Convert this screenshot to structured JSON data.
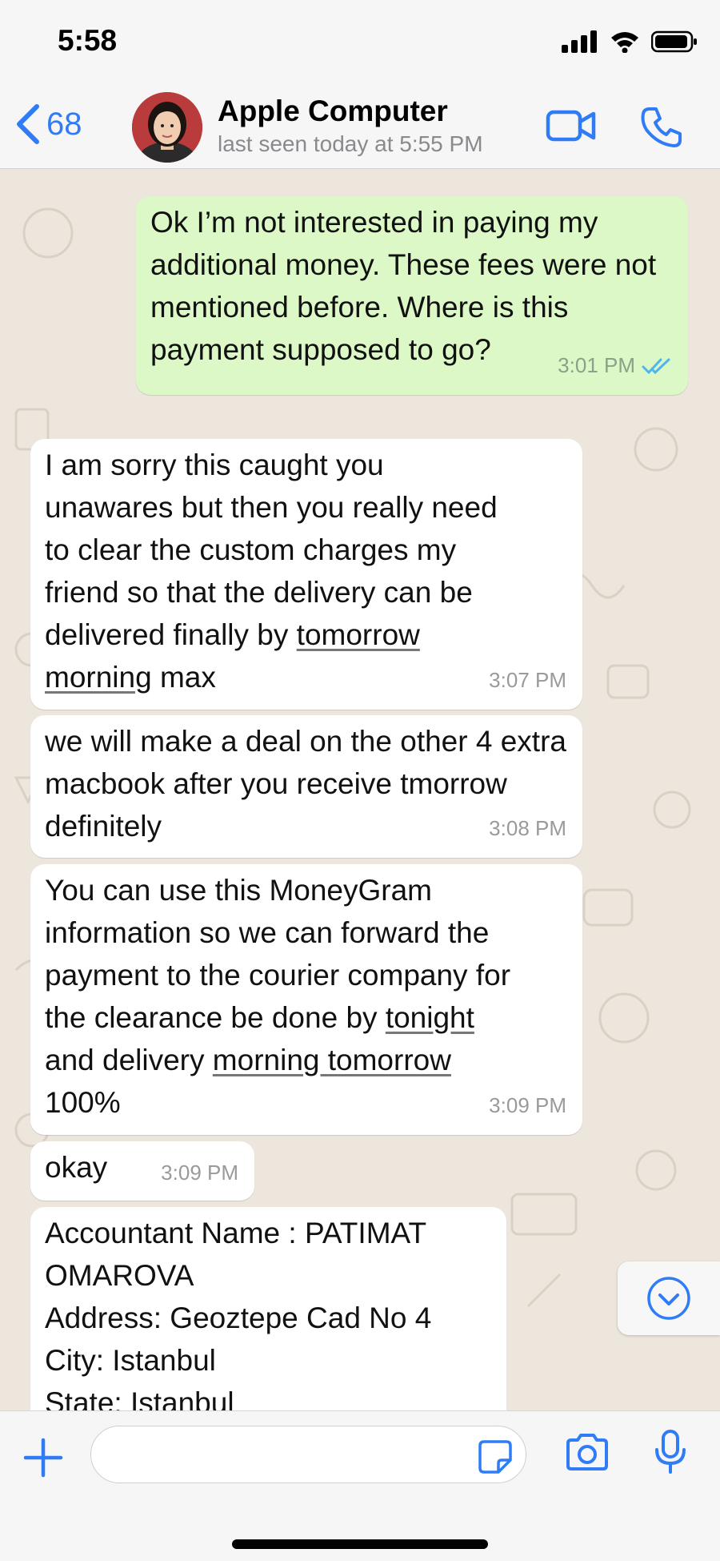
{
  "status_bar": {
    "time": "5:58",
    "icons": [
      "signal-icon",
      "wifi-icon",
      "battery-icon"
    ]
  },
  "header": {
    "back_count": "68",
    "contact_name": "Apple Computer",
    "last_seen": "last seen today at 5:55 PM",
    "icons": [
      "chevron-left-icon",
      "video-call-icon",
      "phone-icon"
    ]
  },
  "messages": [
    {
      "direction": "outgoing",
      "text": "Ok I’m not interested in paying my additional money. These fees were not mentioned before. Where is this payment supposed to go?",
      "time": "3:01 PM",
      "read": true
    },
    {
      "direction": "incoming",
      "text": "I am sorry this caught you unawares but then you really need to clear the custom charges my friend so that the delivery can be delivered finally by tomorrow morning max",
      "time": "3:07 PM"
    },
    {
      "direction": "incoming",
      "text": "we will make a deal on the other 4 extra macbook after you receive tmorrow definitely",
      "time": "3:08 PM"
    },
    {
      "direction": "incoming",
      "text": "You can use this MoneyGram information so we can forward the payment to the courier company for the clearance be done by tonight and delivery morning tomorrow 100%",
      "time": "3:09 PM"
    },
    {
      "direction": "incoming",
      "text": "okay",
      "time": "3:09 PM"
    },
    {
      "direction": "incoming",
      "text": "Accountant Name : PATIMAT OMAROVA\nAddress: Geoztepe Cad No 4\nCity: Istanbul\nState: Istanbul",
      "time": ""
    }
  ],
  "m1": {
    "l1": "I am sorry this caught you",
    "l2": "unawares but then you really need",
    "l3": "to clear the custom charges my",
    "l4": "friend so that the delivery can be",
    "l5a": "delivered finally by ",
    "l5b": "tomorrow",
    "l6a": "morning",
    "l6b": " max"
  },
  "m3": {
    "l1": "You can use this MoneyGram",
    "l2": "information so we can forward the",
    "l3": "payment to the courier company for",
    "l4a": "the clearance be done by ",
    "l4b": "tonight",
    "l5a": "and delivery ",
    "l5b": "morning tomorrow",
    "l6": "100%"
  },
  "input": {
    "placeholder": "",
    "icons": [
      "plus-icon",
      "sticker-icon",
      "camera-icon",
      "microphone-icon"
    ]
  },
  "colors": {
    "accent": "#2f7cf6",
    "outgoing_bubble": "#dcf8c6",
    "incoming_bubble": "#ffffff",
    "chat_background": "#ece6dd",
    "read_ticks": "#4fb6ec"
  }
}
